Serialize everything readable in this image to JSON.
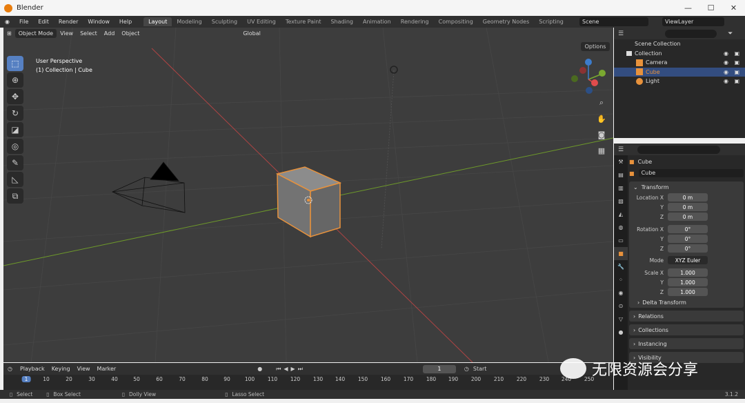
{
  "window": {
    "title": "Blender",
    "controls": [
      "—",
      "☐",
      "✕"
    ]
  },
  "menubar": {
    "items": [
      "File",
      "Edit",
      "Render",
      "Window",
      "Help"
    ],
    "tabs": [
      "Layout",
      "Modeling",
      "Sculpting",
      "UV Editing",
      "Texture Paint",
      "Shading",
      "Animation",
      "Rendering",
      "Compositing",
      "Geometry Nodes",
      "Scripting"
    ],
    "active_tab": "Layout",
    "scene": "Scene",
    "view_layer": "ViewLayer"
  },
  "viewport": {
    "mode": "Object Mode",
    "menus": [
      "View",
      "Select",
      "Add",
      "Object"
    ],
    "orientation": "Global",
    "options": "Options",
    "info_line1": "User Perspective",
    "info_line2": "(1) Collection | Cube"
  },
  "outliner": {
    "scene_collection": "Scene Collection",
    "collection": "Collection",
    "items": [
      {
        "name": "Camera",
        "color": "#e8923c",
        "selected": false
      },
      {
        "name": "Cube",
        "color": "#e8923c",
        "selected": true
      },
      {
        "name": "Light",
        "color": "#e8923c",
        "selected": false
      }
    ]
  },
  "properties": {
    "object_name": "Cube",
    "data_name": "Cube",
    "transform_title": "Transform",
    "location": {
      "x": "0 m",
      "y": "0 m",
      "z": "0 m"
    },
    "rotation": {
      "x": "0°",
      "y": "0°",
      "z": "0°"
    },
    "mode": "XYZ Euler",
    "scale": {
      "x": "1.000",
      "y": "1.000",
      "z": "1.000"
    },
    "labels": {
      "location_x": "Location X",
      "rotation_x": "Rotation X",
      "scale_x": "Scale X",
      "y": "Y",
      "z": "Z",
      "mode": "Mode"
    },
    "sections": [
      "Delta Transform",
      "Relations",
      "Collections",
      "Instancing",
      "Visibility"
    ]
  },
  "timeline": {
    "menus": [
      "Playback",
      "Keying",
      "View",
      "Marker"
    ],
    "current_frame": "1",
    "start_label": "Start",
    "ruler": [
      "10",
      "20",
      "30",
      "40",
      "50",
      "60",
      "70",
      "80",
      "90",
      "100",
      "110",
      "120",
      "130",
      "140",
      "150",
      "160",
      "170",
      "180",
      "190",
      "200",
      "210",
      "220",
      "230",
      "240",
      "250"
    ],
    "current": "1"
  },
  "statusbar": {
    "select": "Select",
    "box_select": "Box Select",
    "dolly_view": "Dolly View",
    "lasso_select": "Lasso Select",
    "version": "3.1.2"
  },
  "watermark": "无限资源会分享",
  "colors": {
    "accent": "#5680c2",
    "selection": "#e8923c",
    "x_axis": "#e04c4c",
    "y_axis": "#7aa830",
    "z_axis": "#3c7ccc"
  }
}
